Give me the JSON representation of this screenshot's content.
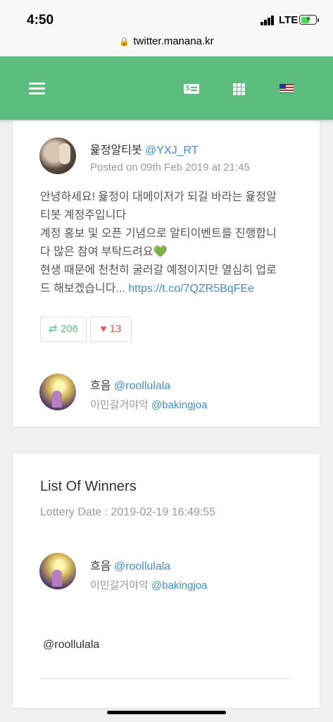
{
  "status_bar": {
    "time": "4:50",
    "network": "LTE",
    "url": "twitter.manana.kr"
  },
  "header": {
    "menu_icon": "hamburger-icon",
    "money_icon": "money-icon",
    "apps_icon": "grid-icon",
    "language_icon": "us-flag-icon",
    "accent_color": "#5dbd7f"
  },
  "tweet": {
    "author_name": "윭정알티봇",
    "author_handle": "@YXJ_RT",
    "posted": "Posted on 09th Feb 2019 at 21:45",
    "lines": [
      "안녕하세요! 윭정이 대메이저가 되길 바라는 윭정알",
      "티봇 계정주입니다",
      "계정 홍보 및 오픈 기념으로 알티이벤트를 진행합니",
      "다 많은 참여 부탁드려요💚",
      "현생 때문에 천천히 굴러갈 예정이지만 열심히 업로"
    ],
    "last_line_text": "드 해보겠습니다... ",
    "link": "https://t.co/7QZR5BqFEe",
    "retweets": "206",
    "likes": "13",
    "retweet_icon": "retweet-icon",
    "heart_icon": "heart-icon"
  },
  "participant": {
    "name": "흐음",
    "handle": "@roollulala",
    "sub_name": "이민갈거야악",
    "sub_handle": "@bakingjoa"
  },
  "winners": {
    "title": "List Of Winners",
    "lottery_date": "Lottery Date : 2019-02-19 16:49:55",
    "winner": {
      "name": "흐음",
      "handle": "@roollulala",
      "sub_name": "이민갈거야악",
      "sub_handle": "@bakingjoa"
    },
    "winner_list_handle": "@roollulala"
  }
}
